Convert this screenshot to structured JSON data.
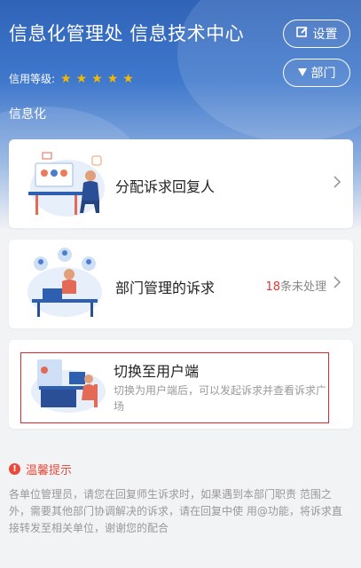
{
  "header": {
    "title": "信息化管理处 信息技术中心",
    "settings_label": "设置",
    "settings_icon": "edit-icon",
    "dept_label": "部门",
    "dept_icon": "triangle-down-icon",
    "credit_label": "信用等级:",
    "credit_stars": 5,
    "department": "信息化"
  },
  "cards": [
    {
      "label": "分配诉求回复人",
      "icon": "assign-illustration"
    },
    {
      "label": "部门管理的诉求",
      "pending_count": "18",
      "pending_suffix": "条未处理",
      "icon": "manage-illustration"
    },
    {
      "label": "切换至用户端",
      "description": "切换为用户端后，可以发起诉求并查看诉求广场",
      "icon": "switch-illustration"
    }
  ],
  "tips": {
    "title": "温馨提示",
    "body": "各单位管理员，请您在回复师生诉求时，如果遇到本部门职责 范围之外，需要其他部门协调解决的诉求，请在回复中使 用@功能，将诉求直接转发至相关单位，谢谢您的配合"
  },
  "colors": {
    "accent": "#2f63b8",
    "warning": "#e84b3c",
    "star": "#f5b800",
    "highlight_border": "#e0282e"
  }
}
